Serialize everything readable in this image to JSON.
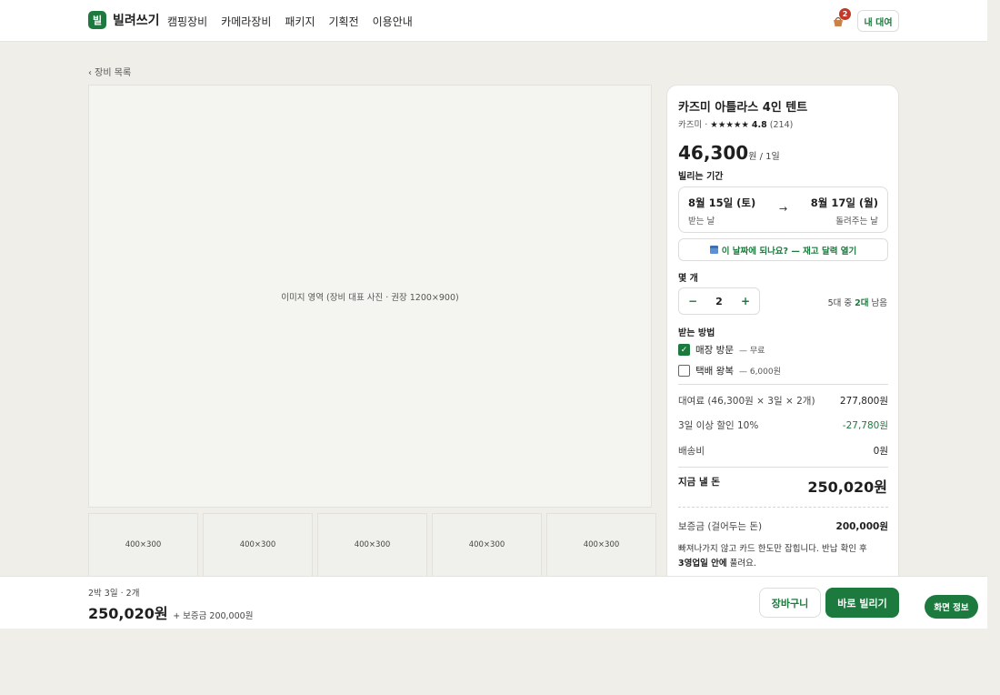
{
  "brand": {
    "logo_char": "빌",
    "name": "빌려쓰기"
  },
  "nav": [
    "캠핑장비",
    "카메라장비",
    "패키지",
    "기획전",
    "이용안내"
  ],
  "header": {
    "cart_count": "2",
    "my_rent": "내 대여"
  },
  "back_link": "‹ 장비 목록",
  "hero_caption": "이미지 영역 (장비 대표 사진 · 권장 1200×900)",
  "thumbs": [
    "400×300",
    "400×300",
    "400×300",
    "400×300",
    "400×300"
  ],
  "product": {
    "title": "카즈미 아틀라스 4인 텐트",
    "brand": "카즈미 ·",
    "stars": "★★★★★",
    "rating": "4.8",
    "reviews": "(214)",
    "price": "46,300",
    "price_unit": "원 / 1일"
  },
  "period": {
    "label": "빌리는 기간",
    "from": "8월 15일 (토)",
    "from_caption": "받는 날",
    "arrow": "→",
    "to": "8월 17일 (월)",
    "to_caption": "돌려주는 날",
    "calendar_button": "이 날짜에 되나요? — 재고 달력 열기"
  },
  "quantity": {
    "label": "몇 개",
    "minus": "−",
    "value": "2",
    "plus": "+",
    "stock_prefix": "5대 중 ",
    "stock_left": "2대",
    "stock_suffix": " 남음"
  },
  "pickup": {
    "label": "받는 방법",
    "options": [
      {
        "label": "매장 방문",
        "note": "— 무료",
        "checked": true
      },
      {
        "label": "택배 왕복",
        "note": "— 6,000원",
        "checked": false
      }
    ]
  },
  "breakdown": [
    {
      "label": "대여료 (46,300원 × 3일 × 2개)",
      "value": "277,800원"
    },
    {
      "label": "3일 이상 할인 10%",
      "value": "-27,780원"
    },
    {
      "label": "배송비",
      "value": "0원"
    }
  ],
  "total": {
    "label": "지금 낼 돈",
    "value": "250,020원"
  },
  "deposit": {
    "label": "보증금",
    "label_note": " (걸어두는 돈)",
    "value": "200,000원"
  },
  "note": {
    "line1": "빠져나가지 않고 카드 한도만 잡힙니다. 반납 확인 후",
    "bold": "3영업일 안에",
    "rest": " 풀려요."
  },
  "bottom": {
    "summary": "2박 3일 · 2개",
    "total": "250,020원",
    "deposit": "+ 보증금 200,000원",
    "cart_button": "장바구니",
    "rent_button": "바로 빌리기"
  },
  "screen_info_button": "화면 정보",
  "colors": {
    "accent": "#1d7a3e",
    "badge": "#c0392b",
    "background": "#efeee9"
  }
}
